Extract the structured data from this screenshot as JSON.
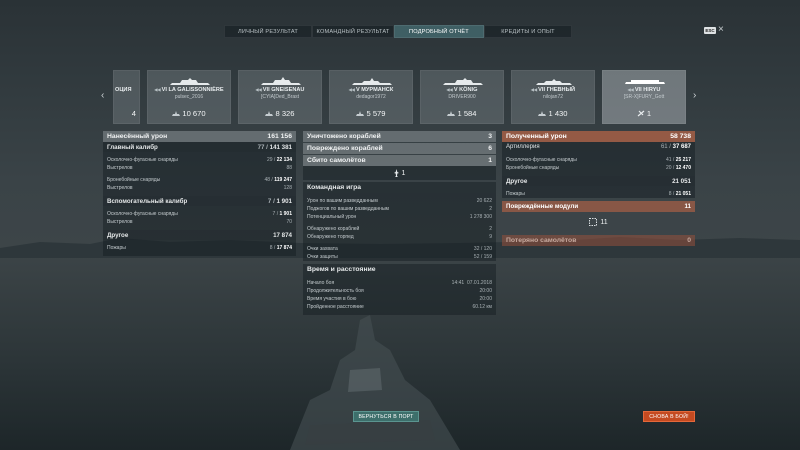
{
  "tabs": [
    {
      "label": "ЛИЧНЫЙ РЕЗУЛЬТАТ",
      "active": false
    },
    {
      "label": "КОМАНДНЫЙ РЕЗУЛЬТАТ",
      "active": false
    },
    {
      "label": "ПОДРОБНЫЙ ОТЧЁТ",
      "active": true
    },
    {
      "label": "КРЕДИТЫ И ОПЫТ",
      "active": false
    }
  ],
  "esc_label": "ESC",
  "ships": [
    {
      "name": "ОЦИЯ",
      "player": "",
      "value": "4",
      "stat_icon": "damage-icon",
      "partial": true
    },
    {
      "name": "VI LA GALISSONNIÈRE",
      "player": "pulsec_2016",
      "value": "10 670",
      "stat_icon": "damage-icon"
    },
    {
      "name": "VII GNEISENAU",
      "player": "[CYIA]Ded_Brast",
      "value": "8 326",
      "stat_icon": "damage-icon"
    },
    {
      "name": "V МУРМАНСК",
      "player": "dedagor1972",
      "value": "5 579",
      "stat_icon": "damage-icon"
    },
    {
      "name": "V KÖNIG",
      "player": "DRIVER900",
      "value": "1 584",
      "stat_icon": "damage-icon"
    },
    {
      "name": "VII ГНЕВНЫЙ",
      "player": "nilojan72",
      "value": "1 430",
      "stat_icon": "damage-icon"
    },
    {
      "name": "VII HIRYU",
      "player": "[SR-X]FURY_Gott",
      "value": "1",
      "stat_icon": "plane-icon",
      "active": true
    }
  ],
  "damage": {
    "title": "Нанесённый урон",
    "total": "161 156",
    "main": {
      "label": "Главный калибр",
      "val": "77",
      "max": "141 381"
    },
    "main_he": {
      "label": "Осколочно-фугасные снаряды",
      "val": "29",
      "max": "22 134"
    },
    "main_he_shots": {
      "label": "Выстрелов",
      "val": "88"
    },
    "main_ap": {
      "label": "Бронебойные снаряды",
      "val": "48",
      "max": "119 247"
    },
    "main_ap_shots": {
      "label": "Выстрелов",
      "val": "128"
    },
    "secondary": {
      "label": "Вспомогательный калибр",
      "val": "7",
      "max": "1 901"
    },
    "sec_he": {
      "label": "Осколочно-фугасные снаряды",
      "val": "7",
      "max": "1 901"
    },
    "sec_shots": {
      "label": "Выстрелов",
      "val": "70"
    },
    "other": {
      "label": "Другое",
      "val": "17 874"
    },
    "fires": {
      "label": "Пожары",
      "val": "8",
      "max": "17 874"
    }
  },
  "center": {
    "destroyed": {
      "label": "Уничтожено кораблей",
      "val": "3"
    },
    "damaged": {
      "label": "Повреждено кораблей",
      "val": "6"
    },
    "planes": {
      "label": "Сбито самолётов",
      "val": "1"
    },
    "plane_icon_count": "1",
    "team": {
      "title": "Командная игра",
      "spotting_damage": {
        "label": "Урон по вашим разведданным",
        "val": "20 622"
      },
      "spotting_fires": {
        "label": "Поджогов по вашим разведданным",
        "val": "2"
      },
      "potential": {
        "label": "Потенциальный урон",
        "val": "1 278 300"
      },
      "spotted_ships": {
        "label": "Обнаружено кораблей",
        "val": "2"
      },
      "spotted_torps": {
        "label": "Обнаружено торпед",
        "val": "9"
      },
      "capture": {
        "label": "Очки захвата",
        "val": "32",
        "max": "120"
      },
      "defense": {
        "label": "Очки защиты",
        "val": "52",
        "max": "159"
      }
    },
    "time": {
      "title": "Время и расстояние",
      "start": {
        "label": "Начало боя",
        "time": "14:41",
        "date": "07.01.2018"
      },
      "duration": {
        "label": "Продолжительность боя",
        "val": "20:00"
      },
      "participation": {
        "label": "Время участия в бою",
        "val": "20:00"
      },
      "distance": {
        "label": "Пройденное расстояние",
        "val": "60.12 км"
      }
    }
  },
  "received": {
    "title": "Полученный урон",
    "total": "58 738",
    "artillery": {
      "label": "Артиллерия",
      "val": "61",
      "max": "37 687"
    },
    "he": {
      "label": "Осколочно-фугасные снаряды",
      "val": "41",
      "max": "25 217"
    },
    "ap": {
      "label": "Бронебойные снаряды",
      "val": "20",
      "max": "12 470"
    },
    "other": {
      "label": "Другое",
      "val": "21 051"
    },
    "fires": {
      "label": "Пожары",
      "val": "8",
      "max": "21 051"
    },
    "modules": {
      "label": "Повреждённые модули",
      "val": "11"
    },
    "modules_icon_count": "11",
    "planes_lost": {
      "label": "Потеряно самолётов",
      "val": "0"
    }
  },
  "buttons": {
    "port": "ВЕРНУТЬСЯ В ПОРТ",
    "battle": "СНОВА В БОЙ!"
  },
  "colors": {
    "accent_teal": "#3d6f6b",
    "accent_orange": "#c44a21",
    "received_header": "#b4644a"
  }
}
